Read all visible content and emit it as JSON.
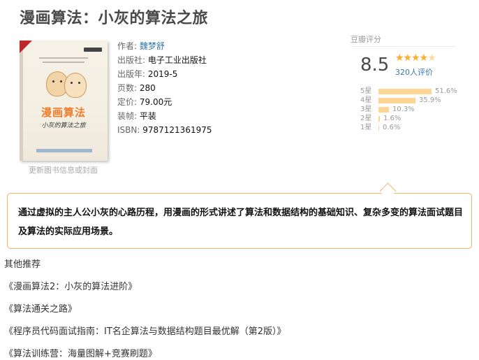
{
  "book": {
    "title": "漫画算法：小灰的算法之旅",
    "cover": {
      "title_text": "漫画算法",
      "subtitle_text": "小灰的算法之旅",
      "update_link": "更新图书信息或封面"
    },
    "info": [
      {
        "label": "作者: ",
        "value": "魏梦舒",
        "is_link": true
      },
      {
        "label": "出版社: ",
        "value": "电子工业出版社",
        "is_link": false
      },
      {
        "label": "出版年: ",
        "value": "2019-5",
        "is_link": false
      },
      {
        "label": "页数: ",
        "value": "280",
        "is_link": false
      },
      {
        "label": "定价: ",
        "value": "79.00元",
        "is_link": false
      },
      {
        "label": "装帧: ",
        "value": "平装",
        "is_link": false
      },
      {
        "label": "ISBN: ",
        "value": "9787121361975",
        "is_link": false
      }
    ]
  },
  "rating": {
    "header": "豆瓣评分",
    "score": "8.5",
    "stars": 4.5,
    "count_text": "320人评价",
    "distribution": [
      {
        "label": "5星",
        "pct_text": "51.6%",
        "pct": 51.6
      },
      {
        "label": "4星",
        "pct_text": "35.9%",
        "pct": 35.9
      },
      {
        "label": "3星",
        "pct_text": "10.3%",
        "pct": 10.3
      },
      {
        "label": "2星",
        "pct_text": "1.6%",
        "pct": 1.6
      },
      {
        "label": "1星",
        "pct_text": "0.6%",
        "pct": 0.6
      }
    ],
    "colors": {
      "star": "#ffac2d",
      "bar": "#ffd596"
    }
  },
  "summary": {
    "text": "通过虚拟的主人公小灰的心路历程，用漫画的形式讲述了算法和数据结构的基础知识、复杂多变的算法面试题目及算法的实际应用场景。"
  },
  "recommendations": {
    "header": "其他推荐",
    "items": [
      "《漫画算法2：小灰的算法进阶》",
      "《算法通关之路》",
      "《程序员代码面试指南：IT名企算法与数据结构题目最优解（第2版）》",
      "《算法训练营：海量图解+竞赛刷题》"
    ]
  },
  "accent_colors": {
    "link": "#3377aa",
    "callout_border": "#f2b06a",
    "title": "#494949"
  }
}
